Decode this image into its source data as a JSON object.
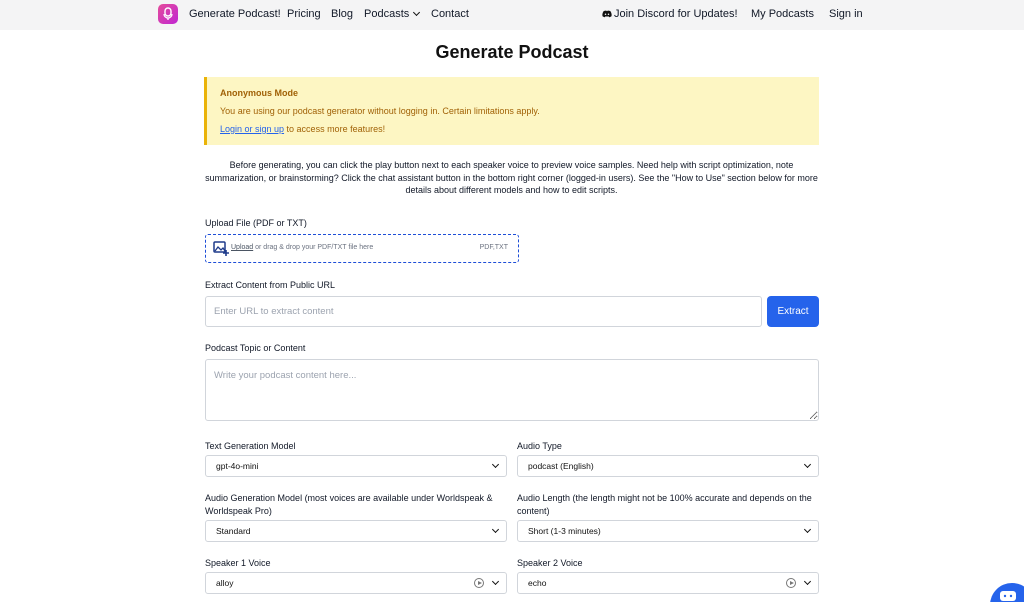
{
  "nav": {
    "brand": "Generate Podcast!",
    "pricing": "Pricing",
    "blog": "Blog",
    "podcasts": "Podcasts",
    "contact": "Contact",
    "discord": "Join Discord for Updates!",
    "my_podcasts": "My Podcasts",
    "sign_in": "Sign in"
  },
  "page": {
    "title": "Generate Podcast"
  },
  "alert": {
    "title": "Anonymous Mode",
    "text": "You are using our podcast generator without logging in. Certain limitations apply.",
    "login_link": "Login or sign up",
    "login_suffix": " to access more features!"
  },
  "intro": "Before generating, you can click the play button next to each speaker voice to preview voice samples. Need help with script optimization, note summarization, or brainstorming? Click the chat assistant button in the bottom right corner (logged-in users). See the \"How to Use\" section below for more details about different models and how to edit scripts.",
  "upload": {
    "label": "Upload File (PDF or TXT)",
    "link": "Upload",
    "text": " or drag & drop your PDF/TXT file here",
    "types": "PDF,TXT"
  },
  "url": {
    "label": "Extract Content from Public URL",
    "placeholder": "Enter URL to extract content",
    "button": "Extract"
  },
  "topic": {
    "label": "Podcast Topic or Content",
    "placeholder": "Write your podcast content here..."
  },
  "fields": {
    "text_model": {
      "label": "Text Generation Model",
      "value": "gpt-4o-mini"
    },
    "audio_type": {
      "label": "Audio Type",
      "value": "podcast (English)"
    },
    "audio_model": {
      "label": "Audio Generation Model (most voices are available under Worldspeak & Worldspeak Pro)",
      "value": "Standard"
    },
    "audio_length": {
      "label": "Audio Length (the length might not be 100% accurate and depends on the content)",
      "value": "Short (1-3 minutes)"
    },
    "speaker1": {
      "label": "Speaker 1 Voice",
      "value": "alloy"
    },
    "speaker2": {
      "label": "Speaker 2 Voice",
      "value": "echo"
    }
  },
  "colors": {
    "accent": "#2563eb",
    "alert_bg": "#fdf6c3",
    "alert_text": "#a16207",
    "logo": "#d63aa8"
  },
  "icons": {
    "logo": "podcast-logo-icon",
    "discord": "discord-icon",
    "upload": "image-upload-icon",
    "chat": "chat-icon",
    "play": "play-circle-icon"
  }
}
